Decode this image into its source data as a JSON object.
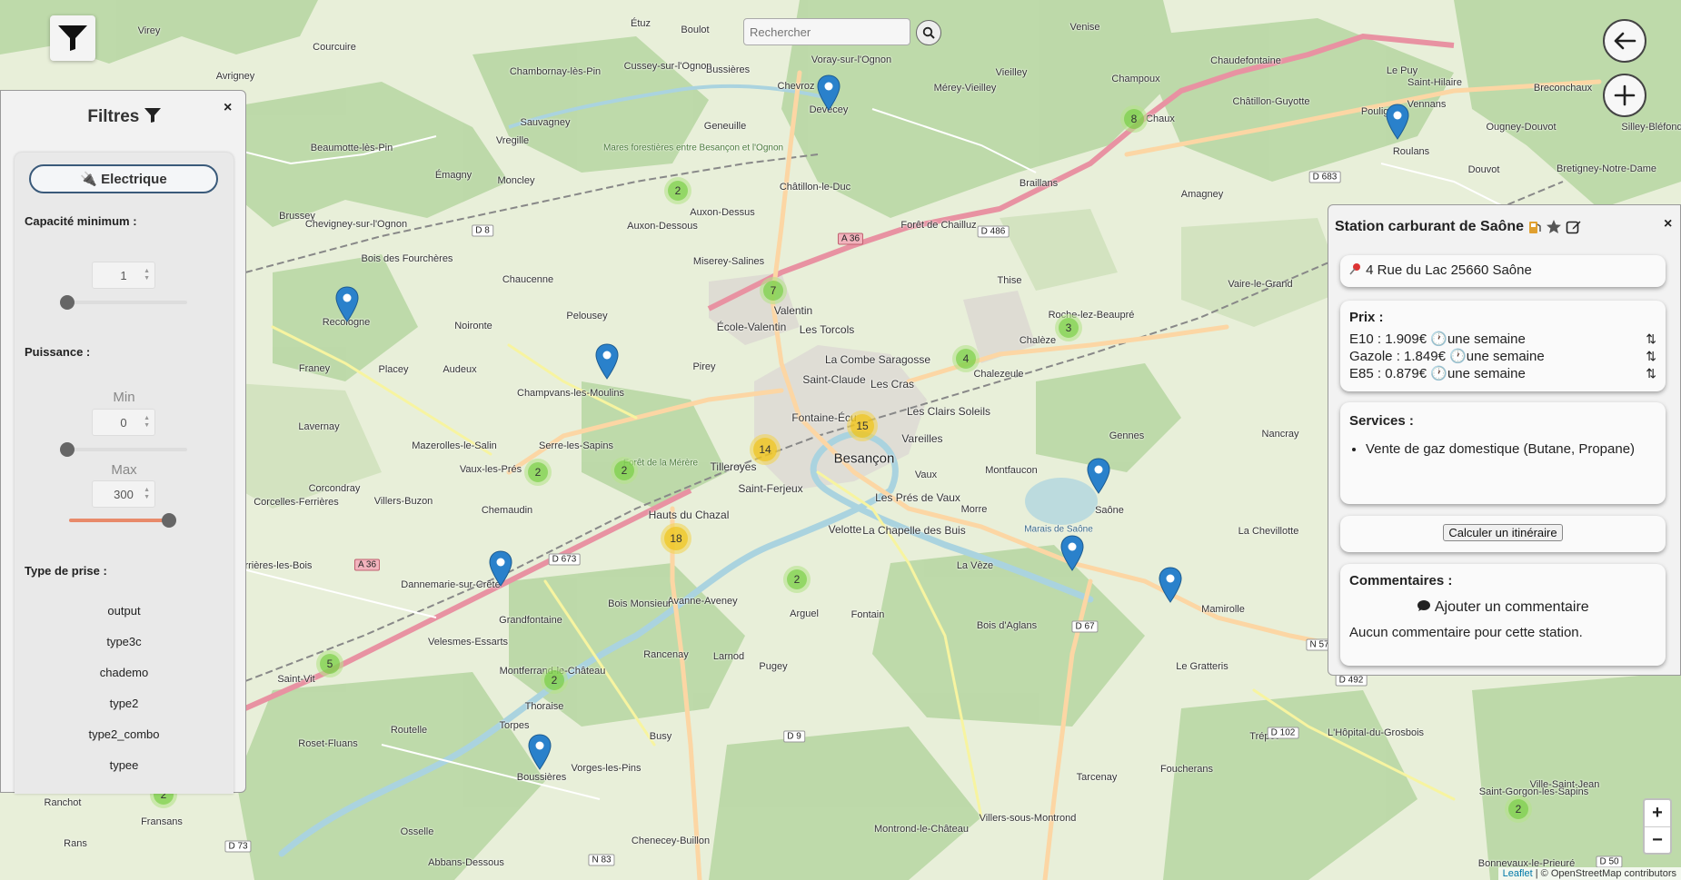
{
  "search": {
    "placeholder": "Rechercher"
  },
  "filters": {
    "title": "Filtres",
    "close": "×",
    "electric_label": "🔌 Electrique",
    "capacity_label": "Capacité minimum :",
    "capacity_value": "1",
    "power_label": "Puissance :",
    "min_label": "Min",
    "min_value": "0",
    "max_label": "Max",
    "max_value": "300",
    "plug_type_label": "Type de prise :",
    "plug_types": [
      "output",
      "type3c",
      "chademo",
      "type2",
      "type2_combo",
      "typee"
    ]
  },
  "station": {
    "title": "Station carburant de Saône",
    "close": "×",
    "address": "4 Rue du Lac 25660 Saône",
    "prices_title": "Prix :",
    "prices": [
      {
        "label": "E10 : 1.909€",
        "age": "une semaine"
      },
      {
        "label": "Gazole : 1.849€",
        "age": "une semaine"
      },
      {
        "label": "E85 : 0.879€",
        "age": "une semaine"
      }
    ],
    "services_title": "Services :",
    "services": [
      "Vente de gaz domestique (Butane, Propane)"
    ],
    "route_button": "Calculer un itinéraire",
    "comments_title": "Commentaires :",
    "add_comment": "Ajouter un commentaire",
    "no_comments": "Aucun commentaire pour cette station."
  },
  "map": {
    "places": [
      {
        "name": "Besançon",
        "size": "big"
      },
      {
        "name": "Saint-Claude"
      },
      {
        "name": "Les Cras"
      },
      {
        "name": "La Combe Saragosse"
      },
      {
        "name": "Les Torcols"
      },
      {
        "name": "Valentin"
      },
      {
        "name": "École-Valentin"
      },
      {
        "name": "Miserey-Salines"
      },
      {
        "name": "Pirey"
      },
      {
        "name": "Les Clairs Soleils"
      },
      {
        "name": "Fontaine-Écu"
      },
      {
        "name": "Chalezeule"
      },
      {
        "name": "Chalèze"
      },
      {
        "name": "Vareilles"
      },
      {
        "name": "Montfaucon"
      },
      {
        "name": "Saône"
      },
      {
        "name": "Gennes"
      },
      {
        "name": "Nancray"
      },
      {
        "name": "La Chevillotte"
      },
      {
        "name": "Mamirolle"
      },
      {
        "name": "Morre"
      },
      {
        "name": "La Vèze"
      },
      {
        "name": "Les Prés de Vaux"
      },
      {
        "name": "La Chapelle des Buis"
      },
      {
        "name": "Velotte"
      },
      {
        "name": "Saint-Ferjeux"
      },
      {
        "name": "Tilleroyes"
      },
      {
        "name": "Hauts du Chazal"
      },
      {
        "name": "Arguel"
      },
      {
        "name": "Fontain"
      },
      {
        "name": "Avanne-Aveney"
      },
      {
        "name": "Rancenay"
      },
      {
        "name": "Larnod"
      },
      {
        "name": "Pugey"
      },
      {
        "name": "Grandfontaine"
      },
      {
        "name": "Velesmes-Essarts"
      },
      {
        "name": "Dannemarie-sur-Crête"
      },
      {
        "name": "Chemaudin"
      },
      {
        "name": "Vaux-les-Prés"
      },
      {
        "name": "Serre-les-Sapins"
      },
      {
        "name": "Champvans-les-Moulins"
      },
      {
        "name": "Pelousey"
      },
      {
        "name": "Placey"
      },
      {
        "name": "Audeux"
      },
      {
        "name": "Noironte"
      },
      {
        "name": "Chaucenne"
      },
      {
        "name": "Recologne"
      },
      {
        "name": "Franey"
      },
      {
        "name": "Lavernay"
      },
      {
        "name": "Mazerolles-le-Salin"
      },
      {
        "name": "Corcondray"
      },
      {
        "name": "Villers-Buzon"
      },
      {
        "name": "Corcelles-Ferrières"
      },
      {
        "name": "Ferrières-les-Bois"
      },
      {
        "name": "Saint-Vit"
      },
      {
        "name": "Roset-Fluans"
      },
      {
        "name": "Torpes"
      },
      {
        "name": "Thoraise"
      },
      {
        "name": "Montferrand-le-Château"
      },
      {
        "name": "Boussières"
      },
      {
        "name": "Routelle"
      },
      {
        "name": "Busy"
      },
      {
        "name": "Vorges-les-Pins"
      },
      {
        "name": "Osselle"
      },
      {
        "name": "Abbans-Dessous"
      },
      {
        "name": "Chenecey-Buillon"
      },
      {
        "name": "Ranchot"
      },
      {
        "name": "Rans"
      },
      {
        "name": "Devecey"
      },
      {
        "name": "Voray-sur-l'Ognon"
      },
      {
        "name": "Chevroz"
      },
      {
        "name": "Geneuille"
      },
      {
        "name": "Bussières"
      },
      {
        "name": "Cussey-sur-l'Ognon"
      },
      {
        "name": "Boulot"
      },
      {
        "name": "Étuz"
      },
      {
        "name": "Chambornay-lès-Pin"
      },
      {
        "name": "Courcuire"
      },
      {
        "name": "Virey"
      },
      {
        "name": "Avrigney"
      },
      {
        "name": "Beaumotte-lès-Pin"
      },
      {
        "name": "Vregille"
      },
      {
        "name": "Sauvagney"
      },
      {
        "name": "Émagny"
      },
      {
        "name": "Moncley"
      },
      {
        "name": "Auxon-Dessus"
      },
      {
        "name": "Auxon-Dessous"
      },
      {
        "name": "Châtillon-le-Duc"
      },
      {
        "name": "Brussey"
      },
      {
        "name": "Chevigney-sur-l'Ognon"
      },
      {
        "name": "Mérey-Vieilley"
      },
      {
        "name": "Vieilley"
      },
      {
        "name": "Venise"
      },
      {
        "name": "Braillans"
      },
      {
        "name": "Amagney"
      },
      {
        "name": "Thise"
      },
      {
        "name": "Roche-lez-Beaupré"
      },
      {
        "name": "Vaire-le-Grand"
      },
      {
        "name": "Champoux"
      },
      {
        "name": "Chaudefontaine"
      },
      {
        "name": "Châtillon-Guyotte"
      },
      {
        "name": "Le Puy"
      },
      {
        "name": "Saint-Hilaire"
      },
      {
        "name": "Pouligney"
      },
      {
        "name": "Vennans"
      },
      {
        "name": "Roulans"
      },
      {
        "name": "Ougney-Douvot"
      },
      {
        "name": "Douvot"
      },
      {
        "name": "Breconchaux"
      },
      {
        "name": "Silley-Bléfond"
      },
      {
        "name": "Bretigney-Notre-Dame"
      },
      {
        "name": "Le Gratteris"
      },
      {
        "name": "Tarcenay"
      },
      {
        "name": "Trépot"
      },
      {
        "name": "Foucherans"
      },
      {
        "name": "Villers-sous-Montrond"
      },
      {
        "name": "Montrond-le-Château"
      },
      {
        "name": "L'Hôpital-du-Grosbois"
      },
      {
        "name": "Saint-Gorgon-les-Sapins"
      },
      {
        "name": "Bonnevaux-le-Prieuré"
      },
      {
        "name": "Fransans"
      },
      {
        "name": "Ville-Saint-Jean"
      },
      {
        "name": "Bois des Fourchères"
      },
      {
        "name": "Bois Monsieur"
      },
      {
        "name": "Bois d'Aglans"
      },
      {
        "name": "Forêt de Chailluz"
      },
      {
        "name": "Mares forestières entre Besançon et l'Ognon"
      },
      {
        "name": "Marais de Saône"
      },
      {
        "name": "Forêt de la Mérère"
      },
      {
        "name": "Chaux"
      },
      {
        "name": "Vaux"
      }
    ],
    "roads": [
      "A 36",
      "A 36",
      "D 486",
      "D 683",
      "D 8",
      "D 673",
      "D 67",
      "D 73",
      "D 9",
      "N 83",
      "D 102",
      "D 492",
      "D 50",
      "N 57"
    ],
    "clusters": [
      {
        "count": 2
      },
      {
        "count": 7
      },
      {
        "count": 8
      },
      {
        "count": 3
      },
      {
        "count": 4
      },
      {
        "count": 15
      },
      {
        "count": 14
      },
      {
        "count": 18
      },
      {
        "count": 2
      },
      {
        "count": 2
      },
      {
        "count": 2
      },
      {
        "count": 5
      },
      {
        "count": 2
      },
      {
        "count": 2
      },
      {
        "count": 2
      }
    ],
    "attribution": {
      "leaflet": "Leaflet",
      "osm": "© OpenStreetMap contributors"
    }
  },
  "zoom": {
    "in": "+",
    "out": "−"
  },
  "colors": {
    "marker": "#2a81cb",
    "cluster_small": "#6ecc39",
    "cluster_medium": "#f0c20c",
    "motorway": "#e892a2",
    "primary": "#fcd6a4",
    "water": "#aad3df",
    "forest": "#add19e"
  }
}
